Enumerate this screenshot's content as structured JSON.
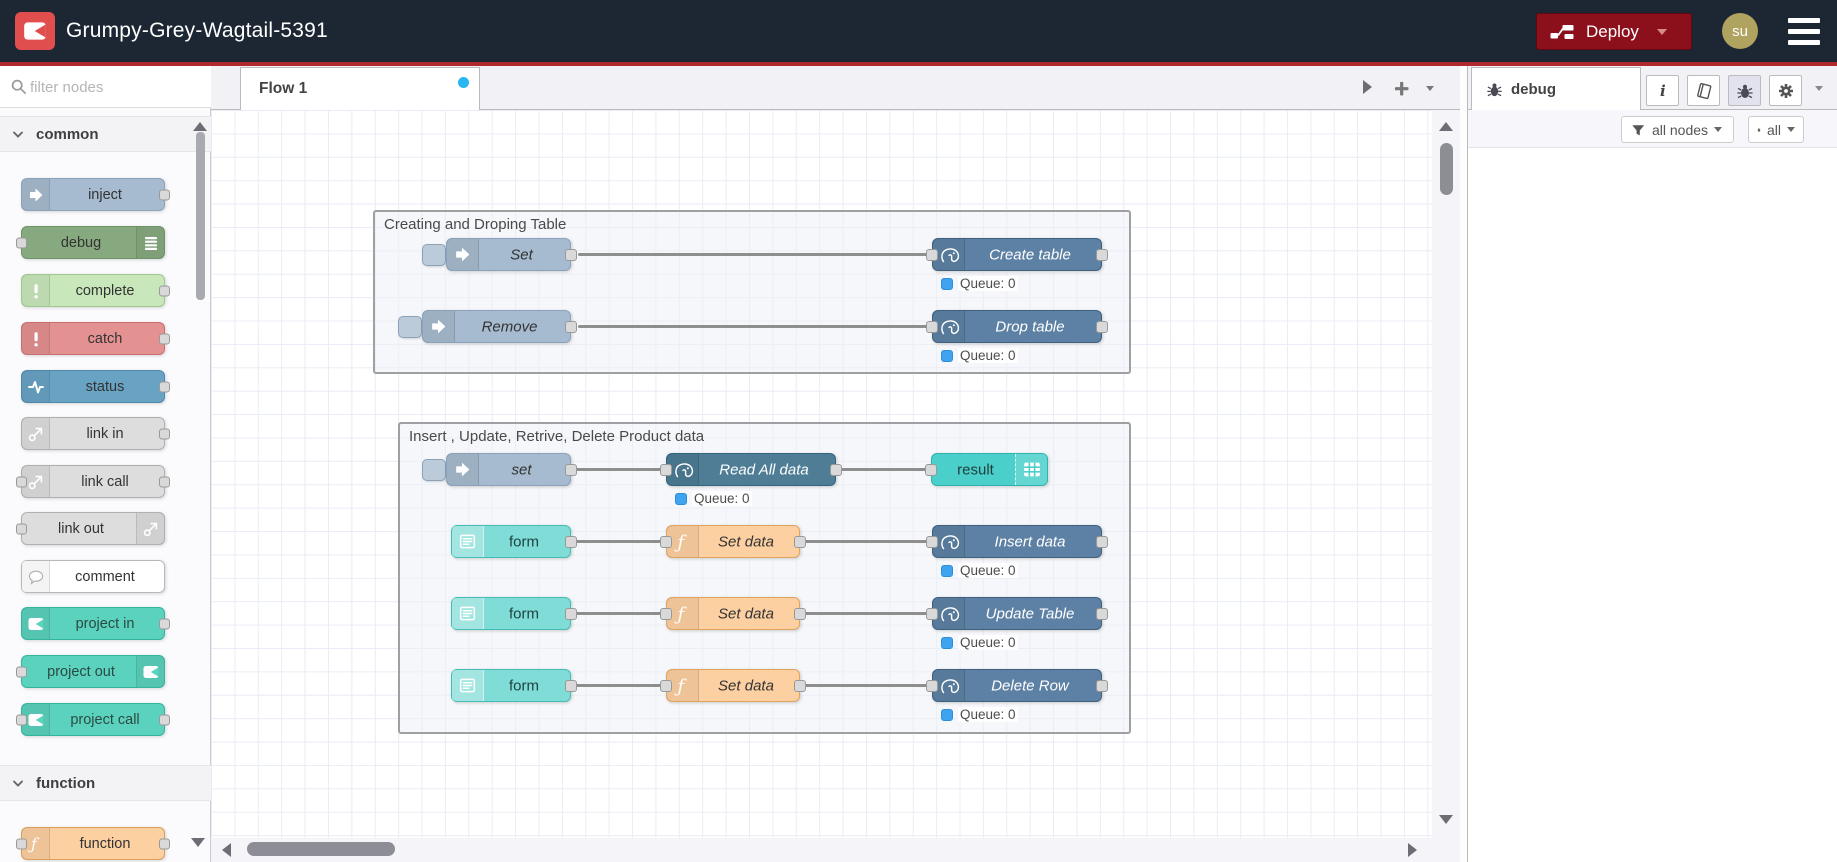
{
  "header": {
    "title": "Grumpy-Grey-Wagtail-5391",
    "deploy_label": "Deploy",
    "avatar_initials": "su"
  },
  "palette": {
    "search_placeholder": "filter nodes",
    "categories": [
      {
        "label": "common",
        "items": [
          {
            "label": "inject",
            "icon": "inject-arrow-icon",
            "color": "#a6bbcf"
          },
          {
            "label": "debug",
            "icon": "list-icon",
            "color": "#87a980"
          },
          {
            "label": "complete",
            "icon": "exclamation-icon",
            "color": "#c8e7ba"
          },
          {
            "label": "catch",
            "icon": "exclamation-icon",
            "color": "#e49191"
          },
          {
            "label": "status",
            "icon": "pulse-icon",
            "color": "#69a3c4"
          },
          {
            "label": "link in",
            "icon": "link-icon",
            "color": "#dddddd"
          },
          {
            "label": "link call",
            "icon": "link-icon",
            "color": "#dddddd"
          },
          {
            "label": "link out",
            "icon": "link-icon",
            "color": "#dddddd"
          },
          {
            "label": "comment",
            "icon": "comment-bubble-icon",
            "color": "#ffffff"
          },
          {
            "label": "project in",
            "icon": "node-red-icon",
            "color": "#5bd2bd"
          },
          {
            "label": "project out",
            "icon": "node-red-icon",
            "color": "#5bd2bd"
          },
          {
            "label": "project call",
            "icon": "node-red-icon",
            "color": "#5bd2bd"
          }
        ]
      },
      {
        "label": "function",
        "items": [
          {
            "label": "function",
            "icon": "function-icon",
            "color": "#fdd0a2"
          }
        ]
      }
    ]
  },
  "workspace": {
    "tab_label": "Flow 1"
  },
  "flow": {
    "group1": {
      "title": "Creating and Droping Table",
      "row1": {
        "inject": "Set",
        "pg": "Create table",
        "status": "Queue: 0"
      },
      "row2": {
        "inject": "Remove",
        "pg": "Drop table",
        "status": "Queue: 0"
      }
    },
    "group2": {
      "title": "Insert , Update, Retrive, Delete Product data",
      "row1": {
        "inject": "set",
        "pg": "Read All data",
        "status": "Queue: 0",
        "result": "result"
      },
      "row2": {
        "form": "form",
        "fn": "Set data",
        "pg": "Insert data",
        "status": "Queue: 0"
      },
      "row3": {
        "form": "form",
        "fn": "Set data",
        "pg": "Update Table",
        "status": "Queue: 0"
      },
      "row4": {
        "form": "form",
        "fn": "Set data",
        "pg": "Delete Row",
        "status": "Queue: 0"
      }
    }
  },
  "sidebar": {
    "tab_label": "debug",
    "filter_button_label": "all nodes",
    "clear_button_label": "all"
  },
  "colors": {
    "header_accent": "#ae2a2d",
    "deploy_red": "#8C101C",
    "postgres_node": "#5d81a4",
    "postgres_node_dark": "#4e7d95",
    "result_node": "#4bcfca",
    "form_node": "#7fdcd6",
    "function_node": "#fdd0a2",
    "inject_node": "#a6bbcf",
    "status_dot_blue": "#40a3ef",
    "flow_dirty_dot": "#29b6f2"
  }
}
